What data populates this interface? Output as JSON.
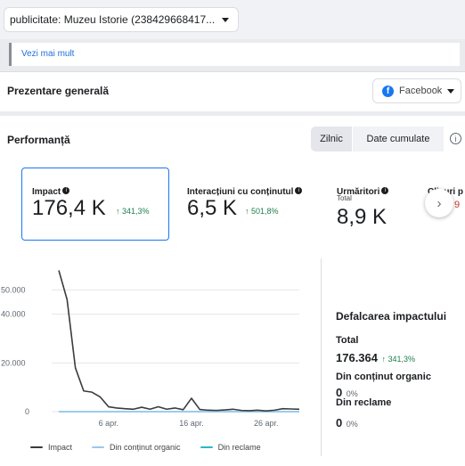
{
  "account_select": {
    "label": "publicitate: Muzeu Istorie (238429668417..."
  },
  "see_more": "Vezi mai mult",
  "overview": {
    "title": "Prezentare generală",
    "platform_select": "Facebook"
  },
  "performance": {
    "title": "Performanță",
    "segments": [
      "Zilnic",
      "Date cumulate"
    ],
    "info_icon": "i"
  },
  "metrics": [
    {
      "label": "Impact",
      "value": "176,4 K",
      "change": "↑ 341,3%"
    },
    {
      "label": "Interacțiuni cu conținutul",
      "value": "6,5 K",
      "change": "↑ 501,8%"
    },
    {
      "label": "Urmăritori",
      "sublabel": "Total",
      "value": "8,9 K"
    },
    {
      "label": "Clicuri p",
      "value": "9"
    }
  ],
  "icons": {
    "info": "info-icon",
    "next": "chevron-right-icon",
    "facebook": "facebook-icon"
  },
  "chart_data": {
    "type": "line",
    "x_ticks": [
      "6 apr.",
      "16 apr.",
      "26 apr."
    ],
    "y_ticks": [
      "50.000",
      "40.000",
      "20.000",
      "0"
    ],
    "ylim": [
      0,
      60000
    ],
    "series": [
      {
        "name": "Impact",
        "color": "#3a3b3c",
        "values": [
          58000,
          46000,
          18000,
          8500,
          8000,
          6000,
          2000,
          1500,
          1200,
          1000,
          1800,
          1000,
          2000,
          1000,
          1500,
          800,
          5500,
          900,
          600,
          500,
          700,
          1000,
          500,
          400,
          600,
          300,
          600,
          1200,
          1100,
          1000
        ]
      },
      {
        "name": "Din conținut organic",
        "color": "#9cc7f0",
        "values": [
          0,
          0,
          0,
          0,
          0,
          0,
          0,
          0,
          0,
          0,
          0,
          0,
          0,
          0,
          0,
          0,
          0,
          0,
          0,
          0,
          0,
          0,
          0,
          0,
          0,
          0,
          0,
          0,
          0,
          0
        ]
      },
      {
        "name": "Din reclame",
        "color": "#2ab8c8",
        "values": [
          0,
          0,
          0,
          0,
          0,
          0,
          0,
          0,
          0,
          0,
          0,
          0,
          0,
          0,
          0,
          0,
          0,
          0,
          0,
          0,
          0,
          0,
          0,
          0,
          0,
          0,
          0,
          0,
          0,
          0
        ]
      }
    ]
  },
  "breakdown": {
    "title": "Defalcarea impactului",
    "total_label": "Total",
    "total_value": "176.364",
    "total_change": "↑ 341,3%",
    "organic_label": "Din conținut organic",
    "organic_value": "0",
    "organic_pct": "0%",
    "ads_label": "Din reclame",
    "ads_value": "0",
    "ads_pct": "0%"
  }
}
